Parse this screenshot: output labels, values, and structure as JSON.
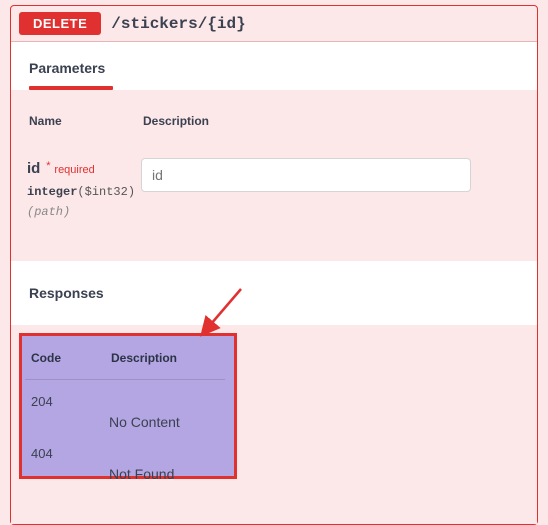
{
  "method": "DELETE",
  "path": "/stickers/{id}",
  "sections": {
    "parameters_title": "Parameters",
    "responses_title": "Responses"
  },
  "param_headers": {
    "name": "Name",
    "description": "Description"
  },
  "parameter": {
    "name": "id",
    "required_star": "*",
    "required_text": "required",
    "type": "integer",
    "format": "($int32)",
    "in": "(path)",
    "placeholder": "id",
    "value": ""
  },
  "responses": {
    "headers": {
      "code": "Code",
      "description": "Description"
    },
    "rows": [
      {
        "code": "204",
        "description": "No Content"
      },
      {
        "code": "404",
        "description": "Not Found"
      }
    ]
  }
}
